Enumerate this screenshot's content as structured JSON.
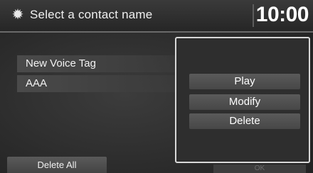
{
  "header": {
    "icon": "gear-icon",
    "title": "Select a contact name",
    "clock": "10:00"
  },
  "list": {
    "items": [
      {
        "label": "New Voice Tag"
      },
      {
        "label": "AAA"
      }
    ]
  },
  "popup": {
    "buttons": [
      {
        "label": "Play"
      },
      {
        "label": "Modify"
      },
      {
        "label": "Delete"
      }
    ]
  },
  "footer": {
    "delete_all_label": "Delete All",
    "ok_label": "OK"
  },
  "colors": {
    "background": "#2c2c2c",
    "text": "#f0f0f0",
    "button": "#4f4f4f",
    "popup_border": "#d8d8d8"
  }
}
